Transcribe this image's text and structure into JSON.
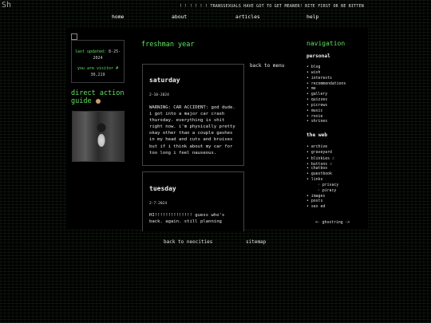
{
  "header": {
    "logo_text": "Sh",
    "marquee": "! ! ! ! ! ! TRANSSEXUALS HAVE GOT TO GET MEANER! BITE FIRST OR BE BITTEN"
  },
  "nav": [
    "home",
    "about",
    "articles",
    "help"
  ],
  "left": {
    "last_updated_label": "last updated:",
    "last_updated_value": "8-25-2024",
    "visitor_label": "you are visitor #",
    "visitor_value": "30,219",
    "direct_action": "direct action guide"
  },
  "main": {
    "page_title": "freshman year",
    "back_to_menu": "back to menu",
    "posts": [
      {
        "title": "saturday",
        "date": "2-10-2024",
        "body": "WARNING: CAR ACCIDENT: god dude. i got into a major car crash thursday. everything is shit right now. i'm physically pretty okay other than a couple gashes in my head and cuts and bruises but if i think about my car for too long i feel nauseous."
      },
      {
        "title": "tuesday",
        "date": "2-7-2024",
        "body": "HI!!!!!!!!!!!!!! guess who's back. again. still planning"
      }
    ]
  },
  "right": {
    "navigation_title": "navigation",
    "personal_title": "personal",
    "personal_items": [
      "blog",
      "wish",
      "interests",
      "recommendations",
      "me",
      "gallery",
      "quizzes",
      "picrews",
      "music",
      "roxie",
      "shrines"
    ],
    "web_title": "the web",
    "web_items": [
      "archive",
      "graveyard",
      "blinkies",
      "buttons",
      "chatbox",
      "guestbook",
      "links"
    ],
    "links_sub": [
      "privacy",
      "piracy"
    ],
    "web_items_2": [
      "images",
      "posts",
      "sex ed"
    ],
    "ghostring": "<- ghostring ->",
    "hand_glyph": "☝"
  },
  "footer": {
    "back_to_neocities": "back to neocities",
    "sitemap": "sitemap"
  },
  "colors": {
    "accent_green": "#5fe35f",
    "background": "#000000"
  }
}
